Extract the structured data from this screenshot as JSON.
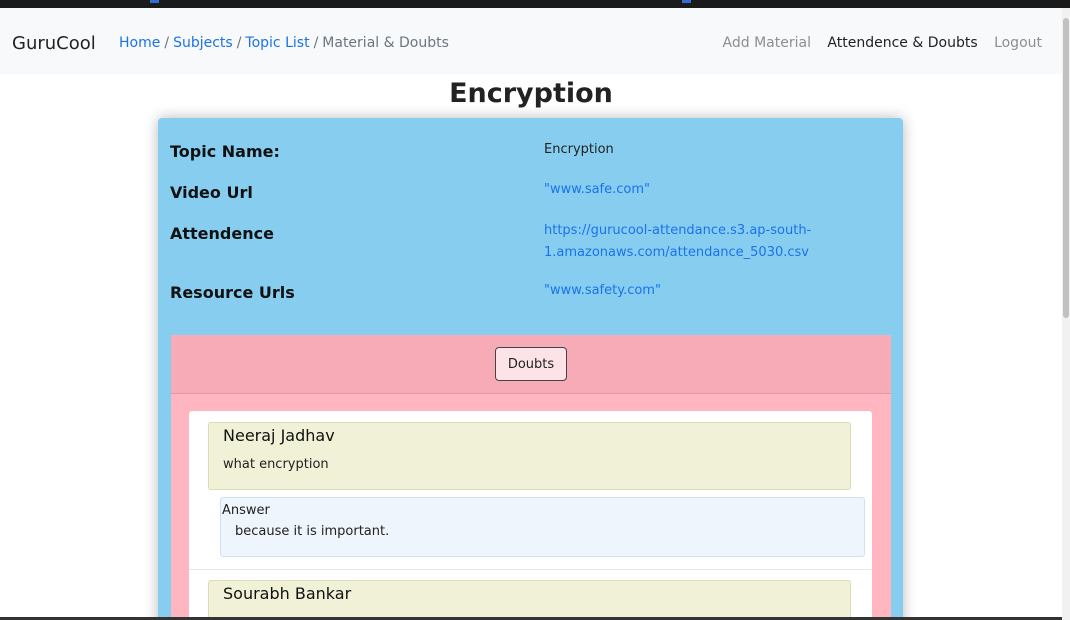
{
  "navbar": {
    "brand": "GuruCool",
    "breadcrumb": [
      "Home",
      "Subjects",
      "Topic List",
      "Material & Doubts"
    ],
    "links": [
      "Add Material",
      "Attendence & Doubts",
      "Logout"
    ]
  },
  "page": {
    "title": "Encryption"
  },
  "details": {
    "topic_label": "Topic Name:",
    "topic_value": "Encryption",
    "video_label": "Video Url",
    "video_value": "\"www.safe.com\"",
    "attendance_label": "Attendence",
    "attendance_line1": "https://gurucool-attendance.s3.ap-south-",
    "attendance_line2": "1.amazonaws.com/attendance_5030.csv",
    "resource_label": "Resource Urls",
    "resource_value": "\"www.safety.com\""
  },
  "doubts": {
    "button_label": "Doubts",
    "items": [
      {
        "name": "Neeraj Jadhav",
        "question": "what encryption",
        "answer_label": "Answer",
        "answer": "because it is important."
      },
      {
        "name": "Sourabh Bankar"
      }
    ]
  }
}
